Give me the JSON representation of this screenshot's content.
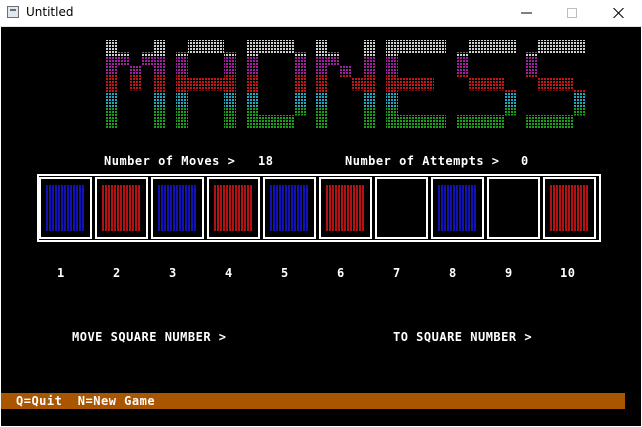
{
  "window": {
    "title": "Untitled"
  },
  "logo": {
    "text": "MADNESS"
  },
  "stats": {
    "moves_label": "Number of Moves >",
    "moves_value": "18",
    "attempts_label": "Number of Attempts >",
    "attempts_value": "0"
  },
  "squares": [
    {
      "number": "1",
      "color": "blue"
    },
    {
      "number": "2",
      "color": "red"
    },
    {
      "number": "3",
      "color": "blue"
    },
    {
      "number": "4",
      "color": "red"
    },
    {
      "number": "5",
      "color": "blue"
    },
    {
      "number": "6",
      "color": "red"
    },
    {
      "number": "7",
      "color": "empty"
    },
    {
      "number": "8",
      "color": "blue"
    },
    {
      "number": "9",
      "color": "empty"
    },
    {
      "number": "10",
      "color": "red"
    }
  ],
  "prompts": {
    "move": "MOVE SQUARE NUMBER >",
    "to": "TO SQUARE NUMBER >"
  },
  "statusbar": {
    "text": "Q=Quit  N=New Game"
  },
  "colors": {
    "blue": "#1212b4",
    "red": "#b41212",
    "status_bg": "#aa5500",
    "logo_band_colors": [
      "#d0d0d0",
      "#a020a0",
      "#c01818",
      "#20a8c0",
      "#18a018"
    ]
  }
}
